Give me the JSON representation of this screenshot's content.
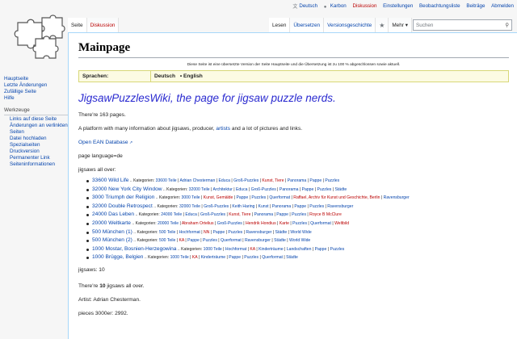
{
  "personal": {
    "language": "Deutsch",
    "user": "Karbon",
    "items": [
      "Diskussion",
      "Einstellungen",
      "Beobachtungsliste",
      "Beiträge",
      "Abmelden"
    ]
  },
  "left_tabs": [
    "Seite",
    "Diskussion"
  ],
  "right_tabs": [
    "Lesen",
    "Übersetzen",
    "Versionsgeschichte"
  ],
  "more_label": "Mehr",
  "search": {
    "placeholder": "Suchen"
  },
  "sidebar": {
    "nav": [
      "Hauptseite",
      "Letzte Änderungen",
      "Zufällige Seite",
      "Hilfe"
    ],
    "tools_heading": "Werkzeuge",
    "tools": [
      "Links auf diese Seite",
      "Änderungen an verlinkten Seiten",
      "Datei hochladen",
      "Spezialseiten",
      "Druckversion",
      "Permanenter Link",
      "Seiteninformationen"
    ]
  },
  "page": {
    "title": "Mainpage",
    "translate_note": "Diese Seite ist eine übersetzte Version der Seite Hauptseite und die Übersetzung ist zu 100 % abgeschlossen sowie aktuell.",
    "lang_label": "Sprachen:",
    "lang_current": "Deutsch",
    "lang_other": "• English",
    "headline": "JigsawPuzzlesWiki, the page for jigsaw puzzle nerds.",
    "pages_count": "There're 163 pages.",
    "platform_pre": "A platform with many information about jigsaws, producer, ",
    "platform_link": "artists",
    "platform_post": " and a lot of pictures and links.",
    "ean_link": "Open EAN Database",
    "page_language": "page language=de",
    "jigsaws_all_over": "jigsaws all over:",
    "jigsaws_count": "jigsaws: 10",
    "there_are": "There're 10 jigsaws all over.",
    "artist": "Artist: Adrian Chesterman.",
    "pieces": "pieces 3000er: 2992."
  },
  "jigsaws": [
    {
      "title": "33600 Wild Life",
      "cat": "Kategorien:",
      "links": [
        [
          "33600 Teile",
          false
        ],
        [
          "Adrian Chesterman",
          false
        ],
        [
          "Educa",
          false
        ],
        [
          "Groß-Puzzles",
          false
        ],
        [
          "Kunst, Tiere",
          true
        ],
        [
          "Panorama",
          false
        ],
        [
          "Pappe",
          false
        ],
        [
          "Puzzles",
          false
        ]
      ]
    },
    {
      "title": "32000 New York City Window",
      "cat": "Kategorien:",
      "links": [
        [
          "32000 Teile",
          false
        ],
        [
          "Architektur",
          false
        ],
        [
          "Educa",
          false
        ],
        [
          "Groß-Puzzles",
          false
        ],
        [
          "Panorama",
          false
        ],
        [
          "Pappe",
          false
        ],
        [
          "Puzzles",
          false
        ],
        [
          "Städte",
          false
        ]
      ]
    },
    {
      "title": "3000 Triumph der Religion",
      "cat": "Kategorien:",
      "links": [
        [
          "3000 Teile",
          false
        ],
        [
          "Kunst, Gemälde",
          true
        ],
        [
          "Pappe",
          false
        ],
        [
          "Puzzles",
          false
        ],
        [
          "Querformat",
          false
        ],
        [
          "Raffael, Archiv für Kunst und Geschichte, Berlin",
          true
        ],
        [
          "Ravensburger",
          false
        ]
      ]
    },
    {
      "title": "32000 Double Retrospect",
      "cat": "Kategorien:",
      "links": [
        [
          "32000 Teile",
          false
        ],
        [
          "Groß-Puzzles",
          false
        ],
        [
          "Keith Haring",
          false
        ],
        [
          "Kunst",
          false
        ],
        [
          "Panorama",
          false
        ],
        [
          "Pappe",
          false
        ],
        [
          "Puzzles",
          false
        ],
        [
          "Ravensburger",
          false
        ]
      ]
    },
    {
      "title": "24000 Das Leben",
      "cat": "Kategorien:",
      "links": [
        [
          "24000 Teile",
          false
        ],
        [
          "Educa",
          false
        ],
        [
          "Groß-Puzzles",
          false
        ],
        [
          "Kunst, Tiere",
          true
        ],
        [
          "Panorama",
          false
        ],
        [
          "Pappe",
          false
        ],
        [
          "Puzzles",
          false
        ],
        [
          "Royce B McClure",
          true
        ]
      ]
    },
    {
      "title": "20000 Weltkarte",
      "cat": "Kategorien:",
      "links": [
        [
          "20000 Teile",
          false
        ],
        [
          "Abraham Ortelius",
          true
        ],
        [
          "Groß-Puzzles",
          false
        ],
        [
          "Hendrik Hondius",
          true
        ],
        [
          "Karte",
          true
        ],
        [
          "Puzzles",
          false
        ],
        [
          "Querformat",
          false
        ],
        [
          "Weltbild",
          true
        ]
      ]
    },
    {
      "title": "500 München (1)",
      "cat": "Kategorien:",
      "links": [
        [
          "500 Teile",
          false
        ],
        [
          "Hochformat",
          false
        ],
        [
          "NN",
          true
        ],
        [
          "Pappe",
          false
        ],
        [
          "Puzzles",
          false
        ],
        [
          "Ravensburger",
          false
        ],
        [
          "Städte",
          false
        ],
        [
          "World Wide",
          false
        ]
      ]
    },
    {
      "title": "500 München (2)",
      "cat": "Kategorien:",
      "links": [
        [
          "500 Teile",
          false
        ],
        [
          "KA",
          true
        ],
        [
          "Pappe",
          false
        ],
        [
          "Puzzles",
          false
        ],
        [
          "Querformat",
          false
        ],
        [
          "Ravensburger",
          false
        ],
        [
          "Städte",
          false
        ],
        [
          "World Wide",
          false
        ]
      ]
    },
    {
      "title": "1000 Mostar, Bosnien-Herzegowina",
      "cat": "Kategorien:",
      "links": [
        [
          "1000 Teile",
          false
        ],
        [
          "Hochformat",
          false
        ],
        [
          "KA",
          true
        ],
        [
          "Kinderträume",
          false
        ],
        [
          "Landschaften",
          false
        ],
        [
          "Pappe",
          false
        ],
        [
          "Puzzles",
          false
        ]
      ]
    },
    {
      "title": "1000 Brügge, Belgien",
      "cat": "Kategorien:",
      "links": [
        [
          "1000 Teile",
          false
        ],
        [
          "KA",
          true
        ],
        [
          "Kinderträume",
          false
        ],
        [
          "Pappe",
          false
        ],
        [
          "Puzzles",
          false
        ],
        [
          "Querformat",
          false
        ],
        [
          "Städte",
          false
        ]
      ]
    }
  ],
  "colors": {
    "link": "#0645ad",
    "redlink": "#ba0000",
    "headline": "#2a2ad0",
    "lang_bar_bg": "#fcfbe3"
  }
}
